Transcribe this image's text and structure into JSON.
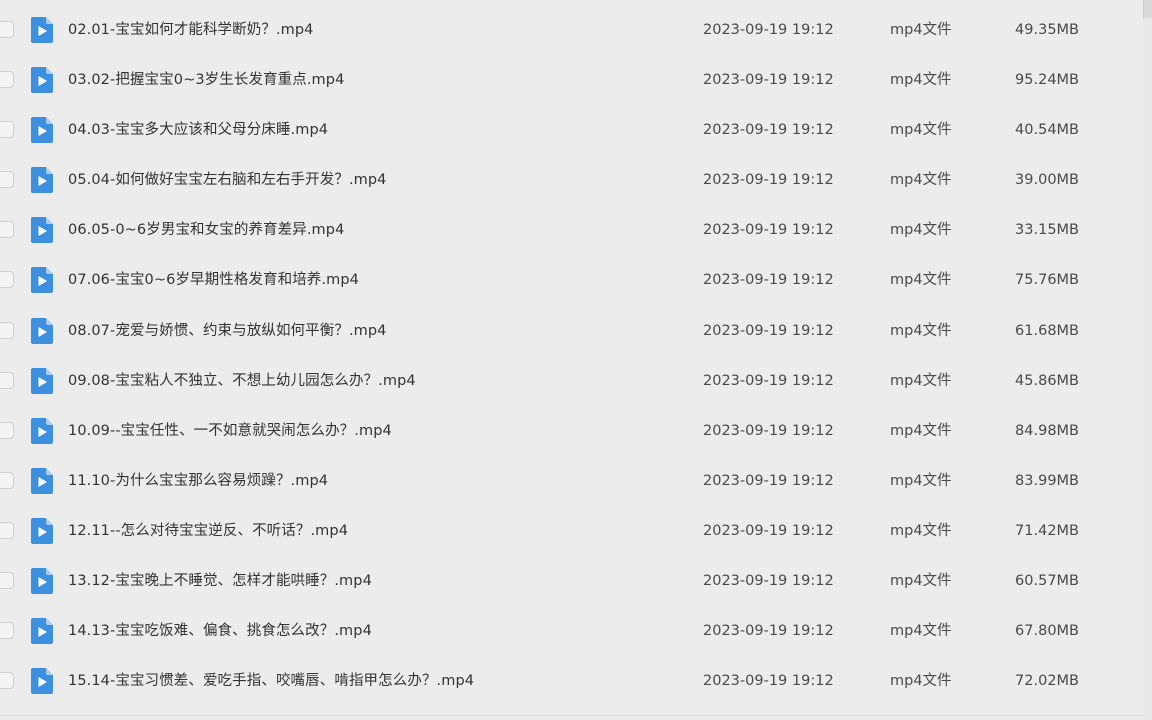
{
  "files": [
    {
      "name": "02.01-宝宝如何才能科学断奶？.mp4",
      "date": "2023-09-19 19:12",
      "type": "mp4文件",
      "size": "49.35MB"
    },
    {
      "name": "03.02-把握宝宝0~3岁生长发育重点.mp4",
      "date": "2023-09-19 19:12",
      "type": "mp4文件",
      "size": "95.24MB"
    },
    {
      "name": "04.03-宝宝多大应该和父母分床睡.mp4",
      "date": "2023-09-19 19:12",
      "type": "mp4文件",
      "size": "40.54MB"
    },
    {
      "name": "05.04-如何做好宝宝左右脑和左右手开发？.mp4",
      "date": "2023-09-19 19:12",
      "type": "mp4文件",
      "size": "39.00MB"
    },
    {
      "name": "06.05-0~6岁男宝和女宝的养育差异.mp4",
      "date": "2023-09-19 19:12",
      "type": "mp4文件",
      "size": "33.15MB"
    },
    {
      "name": "07.06-宝宝0~6岁早期性格发育和培养.mp4",
      "date": "2023-09-19 19:12",
      "type": "mp4文件",
      "size": "75.76MB"
    },
    {
      "name": "08.07-宠爱与娇惯、约束与放纵如何平衡？.mp4",
      "date": "2023-09-19 19:12",
      "type": "mp4文件",
      "size": "61.68MB"
    },
    {
      "name": "09.08-宝宝粘人不独立、不想上幼儿园怎么办？.mp4",
      "date": "2023-09-19 19:12",
      "type": "mp4文件",
      "size": "45.86MB"
    },
    {
      "name": "10.09--宝宝任性、一不如意就哭闹怎么办？.mp4",
      "date": "2023-09-19 19:12",
      "type": "mp4文件",
      "size": "84.98MB"
    },
    {
      "name": "11.10-为什么宝宝那么容易烦躁？.mp4",
      "date": "2023-09-19 19:12",
      "type": "mp4文件",
      "size": "83.99MB"
    },
    {
      "name": "12.11--怎么对待宝宝逆反、不听话？.mp4",
      "date": "2023-09-19 19:12",
      "type": "mp4文件",
      "size": "71.42MB"
    },
    {
      "name": "13.12-宝宝晚上不睡觉、怎样才能哄睡？.mp4",
      "date": "2023-09-19 19:12",
      "type": "mp4文件",
      "size": "60.57MB"
    },
    {
      "name": "14.13-宝宝吃饭难、偏食、挑食怎么改？.mp4",
      "date": "2023-09-19 19:12",
      "type": "mp4文件",
      "size": "67.80MB"
    },
    {
      "name": "15.14-宝宝习惯差、爱吃手指、咬嘴唇、啃指甲怎么办？.mp4",
      "date": "2023-09-19 19:12",
      "type": "mp4文件",
      "size": "72.02MB"
    }
  ],
  "icons": {
    "file_icon": "video-file-icon",
    "file_icon_color": "#3d8fe0",
    "file_icon_fold_color": "#a9cdf3"
  }
}
